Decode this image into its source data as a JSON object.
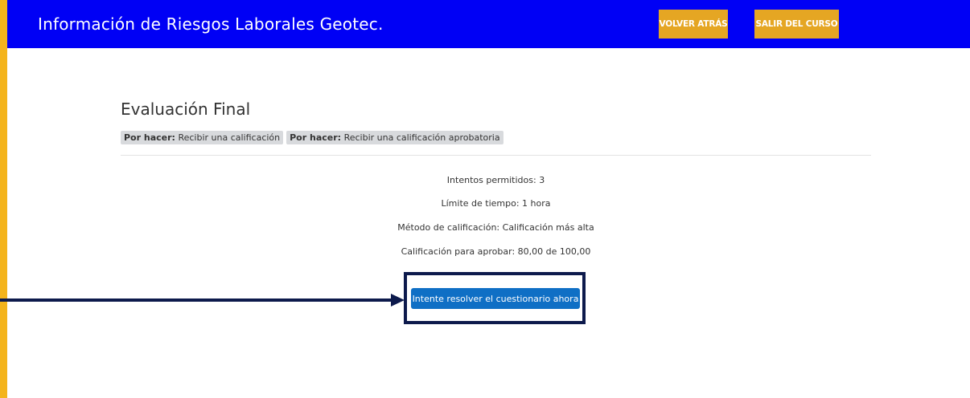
{
  "header": {
    "title": "Información de Riesgos Laborales Geotec.",
    "back_label": "VOLVER ATRÁS",
    "exit_label": "SALIR DEL CURSO"
  },
  "main": {
    "heading": "Evaluación Final",
    "badges": [
      {
        "prefix": "Por hacer:",
        "text": "Recibir una calificación"
      },
      {
        "prefix": "Por hacer:",
        "text": "Recibir una calificación aprobatoria"
      }
    ],
    "info": [
      "Intentos permitidos: 3",
      "Límite de tiempo: 1 hora",
      "Método de calificación: Calificación más alta",
      "Calificación para aprobar: 80,00 de 100,00"
    ],
    "start_button": "Intente resolver el cuestionario ahora"
  },
  "colors": {
    "header_bg": "#0000f5",
    "nav_button_bg": "#e5a623",
    "frame_bg": "#f4b41c",
    "primary_button": "#0f6fc5",
    "highlight": "#0d1a4c"
  },
  "icons": {
    "pointer": "arrow-right-icon"
  }
}
